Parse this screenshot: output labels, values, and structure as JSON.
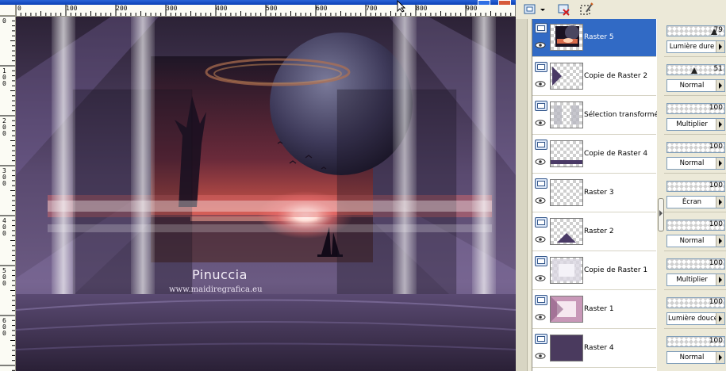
{
  "rulers": {
    "horizontal": [
      "0",
      "100",
      "200",
      "300",
      "400",
      "500",
      "600",
      "700",
      "800",
      "900"
    ],
    "vertical": [
      "0",
      "100",
      "200",
      "300",
      "400",
      "500",
      "600"
    ]
  },
  "artwork": {
    "signature": "Pinuccia",
    "website": "www.maidiregrafica.eu"
  },
  "toolbar": {
    "icons": [
      "new-layer-icon",
      "dropdown-arrow-icon",
      "delete-layer-icon",
      "edit-selection-icon"
    ]
  },
  "layers": [
    {
      "name": "Raster 5",
      "selected": true,
      "opacity": "79",
      "blend_mode": "Lumière dure",
      "thumb": "planet"
    },
    {
      "name": "Copie de Raster 2",
      "selected": false,
      "opacity": "51",
      "blend_mode": "Normal",
      "thumb": "triangle-left"
    },
    {
      "name": "Sélection transformée",
      "selected": false,
      "opacity": "100",
      "blend_mode": "Multiplier",
      "thumb": "selection"
    },
    {
      "name": "Copie de Raster 4",
      "selected": false,
      "opacity": "100",
      "blend_mode": "Normal",
      "thumb": "bottom-band"
    },
    {
      "name": "Raster 3",
      "selected": false,
      "opacity": "100",
      "blend_mode": "Écran",
      "thumb": "empty"
    },
    {
      "name": "Raster 2",
      "selected": false,
      "opacity": "100",
      "blend_mode": "Normal",
      "thumb": "triangle-up"
    },
    {
      "name": "Copie de Raster 1",
      "selected": false,
      "opacity": "100",
      "blend_mode": "Multiplier",
      "thumb": "light-frame"
    },
    {
      "name": "Raster 1",
      "selected": false,
      "opacity": "100",
      "blend_mode": "Lumière douce",
      "thumb": "pink-frame"
    },
    {
      "name": "Raster 4",
      "selected": false,
      "opacity": "100",
      "blend_mode": "Normal",
      "thumb": "purple-fill"
    }
  ],
  "colors": {
    "selection": "#316ac5",
    "panel_bg": "#ece9d8",
    "art_purple": "#4a3a5e"
  }
}
